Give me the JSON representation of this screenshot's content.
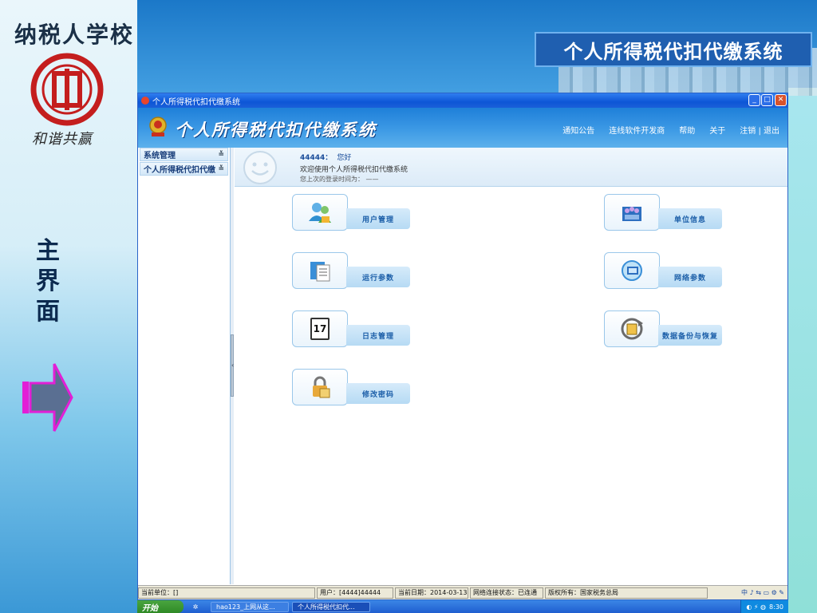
{
  "slide": {
    "school_name": "纳税人学校",
    "motto": "和谐共赢",
    "title": "个人所得税代扣代缴系统",
    "side_caption": [
      "主",
      "界",
      "面"
    ]
  },
  "window": {
    "title": "个人所得税代扣代缴系统",
    "buttons": {
      "minimize": "_",
      "maximize": "□",
      "close": "✕"
    }
  },
  "app": {
    "title": "个人所得税代扣代缴系统",
    "nav": [
      "通知公告",
      "连线软件开发商",
      "帮助",
      "关于",
      "注销 | 退出"
    ]
  },
  "sidebar": {
    "items": [
      {
        "label": "系统管理",
        "chevron": "≚"
      },
      {
        "label": "个人所得税代扣代缴",
        "chevron": "≚"
      }
    ],
    "splitter_glyph": "‹"
  },
  "welcome": {
    "username": "44444：",
    "greeting": "您好",
    "message": "欢迎使用个人所得税代扣代缴系统",
    "last_login": "您上次的登录时间为：  ——"
  },
  "tiles": [
    {
      "label": "用户管理",
      "icon": "users-icon"
    },
    {
      "label": "单位信息",
      "icon": "organization-icon"
    },
    {
      "label": "运行参数",
      "icon": "parameters-icon"
    },
    {
      "label": "网络参数",
      "icon": "network-icon"
    },
    {
      "label": "日志管理",
      "icon": "calendar-icon",
      "icon_text": "17"
    },
    {
      "label": "数据备份与恢复",
      "icon": "backup-icon"
    },
    {
      "label": "修改密码",
      "icon": "lock-icon"
    }
  ],
  "status_bar": {
    "unit": "当前单位：[]",
    "user": "用户：[4444]44444",
    "date": "当前日期：2014-03-13",
    "network": "网络连接状态：已连通",
    "copyright": "版权所有：国家税务总局",
    "tray": "中 ♪ ⇆ ▭ ⚙ ✎"
  },
  "taskbar": {
    "start": "开始",
    "tasks": [
      "hao123_上网从这...",
      "个人所得税代扣代..."
    ],
    "clock": "8:30"
  },
  "colors": {
    "accent": "#1e7fd9",
    "title_box": "#1f5fb0",
    "arrow": "#e21fd6"
  }
}
